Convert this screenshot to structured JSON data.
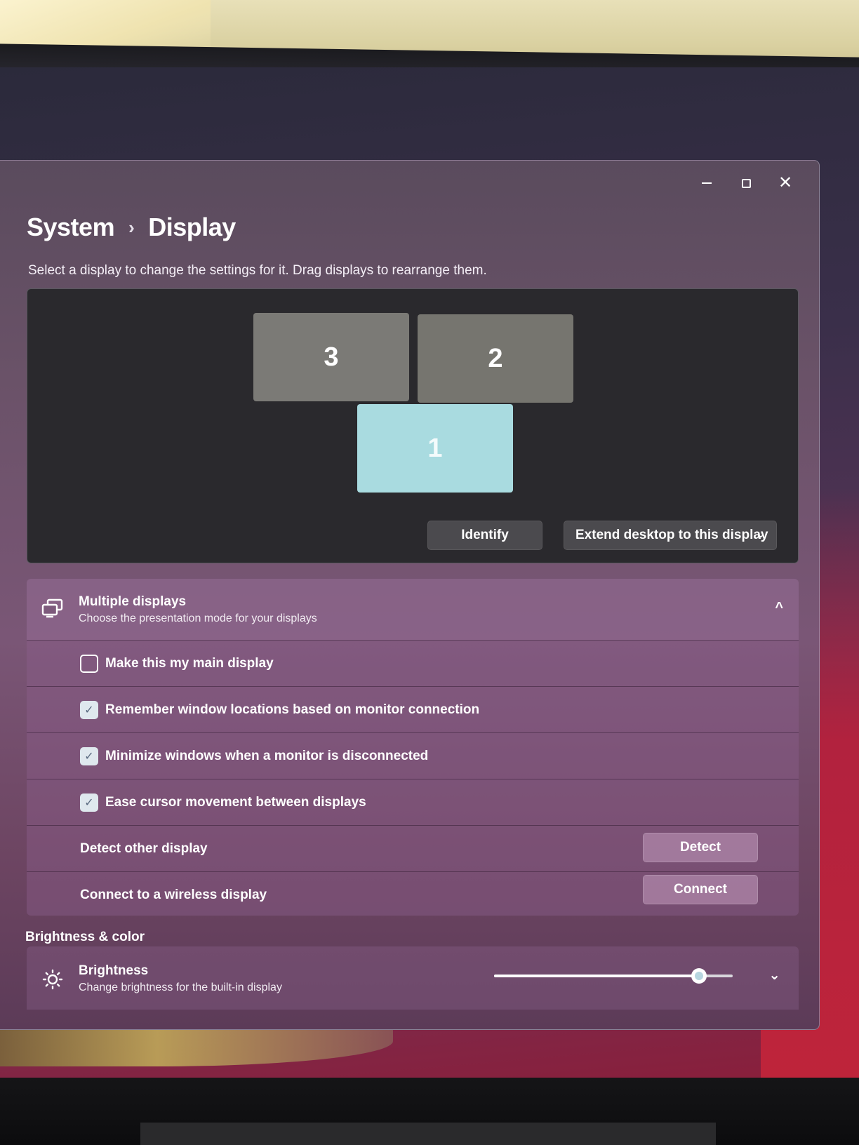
{
  "window": {
    "controls": {
      "minimize": "—",
      "maximize": "",
      "close": "✕"
    }
  },
  "breadcrumb": {
    "parent": "System",
    "separator": "›",
    "current": "Display"
  },
  "subtitle": "Select a display to change the settings for it. Drag displays to rearrange them.",
  "arrangement": {
    "monitors": [
      "3",
      "2",
      "1"
    ],
    "selected_monitor": "1",
    "identify_label": "Identify",
    "extend_label": "Extend desktop to this display",
    "extend_chevron": "⌄"
  },
  "multiple_displays": {
    "title": "Multiple displays",
    "subtitle": "Choose the presentation mode for your displays",
    "expanded": true,
    "chevron": "^",
    "options": [
      {
        "label": "Make this my main display",
        "checked": false
      },
      {
        "label": "Remember window locations based on monitor connection",
        "checked": true
      },
      {
        "label": "Minimize windows when a monitor is disconnected",
        "checked": true
      },
      {
        "label": "Ease cursor movement between displays",
        "checked": true
      }
    ],
    "check_glyph": "✓",
    "detect": {
      "label": "Detect other display",
      "button": "Detect"
    },
    "wireless": {
      "label": "Connect to a wireless display",
      "button": "Connect"
    }
  },
  "brightness_color": {
    "section_title": "Brightness & color",
    "brightness_title": "Brightness",
    "brightness_subtitle": "Change brightness for the built-in display",
    "brightness_value_fraction": 0.86,
    "chevron": "⌄"
  },
  "colors": {
    "selected_monitor": "#a9dbe0",
    "unselected_monitor": "#7b7a76",
    "checkbox_fill": "#dfe8ee"
  }
}
